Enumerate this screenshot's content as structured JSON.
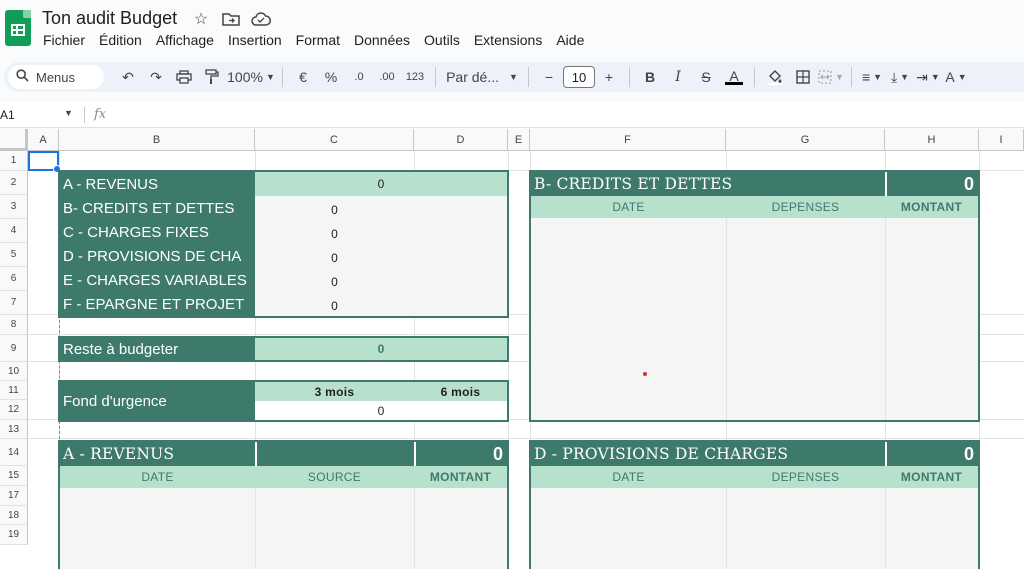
{
  "app": {
    "doc_title": "Ton audit Budget",
    "menu": [
      "Fichier",
      "Édition",
      "Affichage",
      "Insertion",
      "Format",
      "Données",
      "Outils",
      "Extensions",
      "Aide"
    ]
  },
  "toolbar": {
    "menus_label": "Menus",
    "zoom": "100%",
    "currency": "€",
    "percent": "%",
    "dec_decrease": ".0",
    "dec_increase": ".00",
    "number_format": "123",
    "font_name": "Par dé...",
    "font_size": "10",
    "minus": "−",
    "plus": "+"
  },
  "formula_bar": {
    "cell_ref": "A1",
    "fx": "fx"
  },
  "columns": [
    "A",
    "B",
    "C",
    "D",
    "E",
    "F",
    "G",
    "H",
    "I"
  ],
  "rows": [
    "1",
    "2",
    "3",
    "4",
    "5",
    "6",
    "7",
    "8",
    "9",
    "10",
    "11",
    "12",
    "13",
    "14",
    "15",
    "17",
    "18",
    "19"
  ],
  "summary": {
    "rows": [
      {
        "label": "A - REVENUS",
        "value": "0"
      },
      {
        "label": "B- CREDITS ET DETTES",
        "value": "0"
      },
      {
        "label": "C - CHARGES FIXES",
        "value": "0"
      },
      {
        "label": "D - PROVISIONS DE CHA",
        "value": "0"
      },
      {
        "label": "E - CHARGES VARIABLES",
        "value": "0"
      },
      {
        "label": "F - EPARGNE ET PROJET",
        "value": "0"
      }
    ]
  },
  "reste": {
    "label": "Reste à budgeter",
    "value": "0"
  },
  "urgence": {
    "label": "Fond d'urgence",
    "col1": "3 mois",
    "col2": "6 mois",
    "value": "0"
  },
  "credits_table": {
    "title": "B- CREDITS ET DETTES",
    "total": "0",
    "headers": [
      "DATE",
      "DEPENSES",
      "MONTANT"
    ]
  },
  "revenus_table": {
    "title": "A - REVENUS",
    "total": "0",
    "headers": [
      "DATE",
      "SOURCE",
      "MONTANT"
    ]
  },
  "provisions_table": {
    "title": "D - PROVISIONS DE CHARGES",
    "total": "0",
    "headers": [
      "DATE",
      "DEPENSES",
      "MONTANT"
    ]
  },
  "colors": {
    "dark_green": "#3e7a6c",
    "light_green": "#b7e1cd",
    "selection": "#1a73e8"
  }
}
